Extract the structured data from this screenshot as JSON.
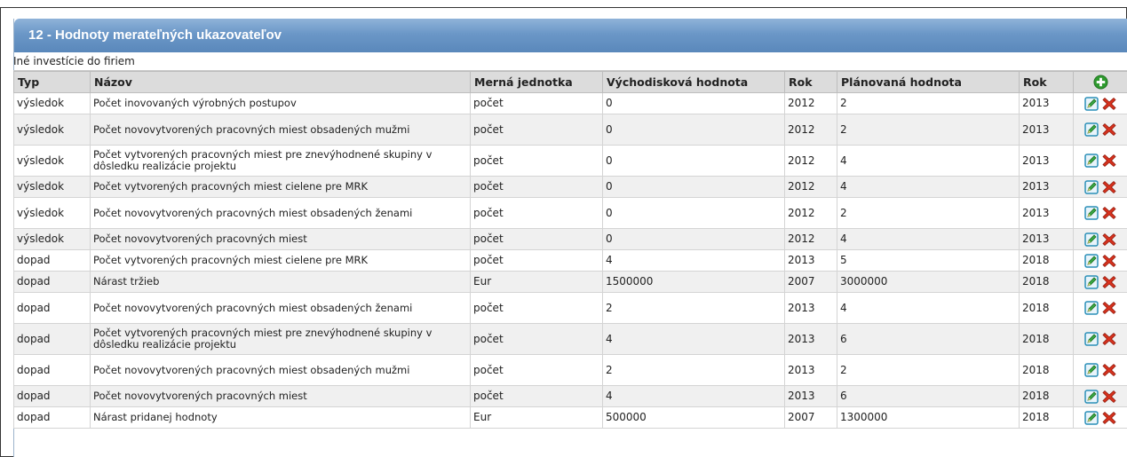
{
  "top_text": "... ... ... ... ... ... ... ... ... ...",
  "panel": {
    "title": "12 - Hodnoty merateľných ukazovateľov",
    "subtitle": "Iné investície do firiem"
  },
  "table": {
    "headers": {
      "typ": "Typ",
      "nazov": "Názov",
      "jednotka": "Merná jednotka",
      "vychodiskova": "Východisková hodnota",
      "rok1": "Rok",
      "planovana": "Plánovaná hodnota",
      "rok2": "Rok"
    },
    "rows": [
      {
        "typ": "výsledok",
        "nazov": "Počet inovovaných výrobných postupov",
        "jednotka": "počet",
        "vychodiskova": "0",
        "rok1": "2012",
        "planovana": "2",
        "rok2": "2013"
      },
      {
        "typ": "výsledok",
        "nazov": "Počet novovytvorených pracovných miest obsadených mužmi",
        "jednotka": "počet",
        "vychodiskova": "0",
        "rok1": "2012",
        "planovana": "2",
        "rok2": "2013"
      },
      {
        "typ": "výsledok",
        "nazov": "Počet vytvorených pracovných miest pre znevýhodnené skupiny v dôsledku realizácie projektu",
        "jednotka": "počet",
        "vychodiskova": "0",
        "rok1": "2012",
        "planovana": "4",
        "rok2": "2013"
      },
      {
        "typ": "výsledok",
        "nazov": "Počet vytvorených pracovných miest cielene pre MRK",
        "jednotka": "počet",
        "vychodiskova": "0",
        "rok1": "2012",
        "planovana": "4",
        "rok2": "2013"
      },
      {
        "typ": "výsledok",
        "nazov": "Počet novovytvorených pracovných miest obsadených ženami",
        "jednotka": "počet",
        "vychodiskova": "0",
        "rok1": "2012",
        "planovana": "2",
        "rok2": "2013"
      },
      {
        "typ": "výsledok",
        "nazov": "Počet novovytvorených pracovných miest",
        "jednotka": "počet",
        "vychodiskova": "0",
        "rok1": "2012",
        "planovana": "4",
        "rok2": "2013"
      },
      {
        "typ": "dopad",
        "nazov": "Počet vytvorených pracovných miest cielene pre MRK",
        "jednotka": "počet",
        "vychodiskova": "4",
        "rok1": "2013",
        "planovana": "5",
        "rok2": "2018"
      },
      {
        "typ": "dopad",
        "nazov": "Nárast tržieb",
        "jednotka": "Eur",
        "vychodiskova": "1500000",
        "rok1": "2007",
        "planovana": "3000000",
        "rok2": "2018"
      },
      {
        "typ": "dopad",
        "nazov": "Počet novovytvorených pracovných miest obsadených ženami",
        "jednotka": "počet",
        "vychodiskova": "2",
        "rok1": "2013",
        "planovana": "4",
        "rok2": "2018"
      },
      {
        "typ": "dopad",
        "nazov": "Počet vytvorených pracovných miest pre znevýhodnené skupiny v dôsledku realizácie projektu",
        "jednotka": "počet",
        "vychodiskova": "4",
        "rok1": "2013",
        "planovana": "6",
        "rok2": "2018"
      },
      {
        "typ": "dopad",
        "nazov": "Počet novovytvorených pracovných miest obsadených mužmi",
        "jednotka": "počet",
        "vychodiskova": "2",
        "rok1": "2013",
        "planovana": "2",
        "rok2": "2018"
      },
      {
        "typ": "dopad",
        "nazov": "Počet novovytvorených pracovných miest",
        "jednotka": "počet",
        "vychodiskova": "4",
        "rok1": "2013",
        "planovana": "6",
        "rok2": "2018"
      },
      {
        "typ": "dopad",
        "nazov": "Nárast pridanej hodnoty",
        "jednotka": "Eur",
        "vychodiskova": "500000",
        "rok1": "2007",
        "planovana": "1300000",
        "rok2": "2018"
      }
    ]
  },
  "icons": {
    "add": "add-circle-icon",
    "edit": "edit-icon",
    "delete": "delete-x-icon"
  },
  "colors": {
    "header_bar": "#6b97c7",
    "add_green": "#2e9a2e",
    "delete_red": "#d8321e",
    "edit_teal": "#2a8fb8"
  }
}
